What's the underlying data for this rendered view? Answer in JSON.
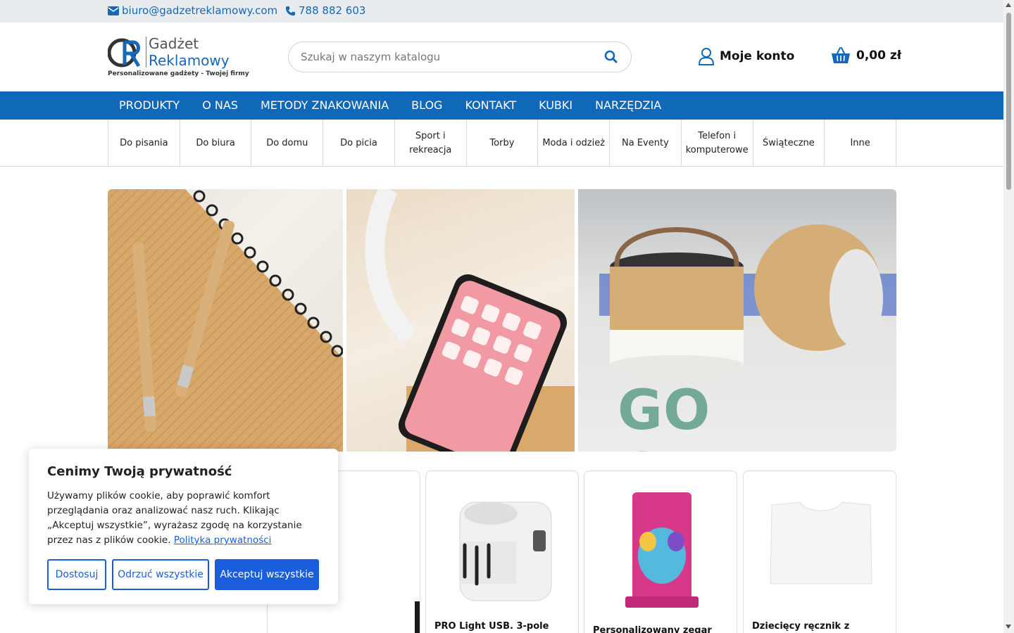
{
  "topbar": {
    "email": "biuro@gadzetreklamowy.com",
    "phone": "788 882 603"
  },
  "logo": {
    "line1": "Gadżet",
    "line2": "Reklamowy",
    "tagline": "Personalizowane gadżety - Twojej firmy"
  },
  "search": {
    "placeholder": "Szukaj w naszym katalogu"
  },
  "header": {
    "account_label": "Moje konto",
    "cart_total": "0,00 zł"
  },
  "main_nav": [
    "PRODUKTY",
    "O NAS",
    "METODY ZNAKOWANIA",
    "BLOG",
    "KONTAKT",
    "KUBKI",
    "NARZĘDZIA"
  ],
  "categories": [
    "Do pisania",
    "Do biura",
    "Do domu",
    "Do picia",
    "Sport i rekreacja",
    "Torby",
    "Moda i odzież",
    "Na Eventy",
    "Telefon i komputerowe",
    "Świąteczne",
    "Inne"
  ],
  "hero": {
    "banner_text": "GO GREEN"
  },
  "products": [
    {
      "title": ""
    },
    {
      "title": "PRO Light USB. 3-pole"
    },
    {
      "title": "Personalizowany zegar"
    },
    {
      "title": "Dziecięcy ręcznik z kapturem"
    }
  ],
  "cookie": {
    "title": "Cenimy Twoją prywatność",
    "text": "Używamy plików cookie, aby poprawić komfort przeglądania oraz analizować nasz ruch. Klikając „Akceptuj wszystkie”, wyrażasz zgodę na korzystanie przez nas z plików cookie.",
    "policy_link": "Polityka prywatności",
    "btn_customize": "Dostosuj",
    "btn_reject": "Odrzuć wszystkie",
    "btn_accept": "Akceptuj wszystkie"
  },
  "colors": {
    "brand_blue": "#0f68b8",
    "cookie_blue": "#1a5edb",
    "green_banner": "#74a996"
  }
}
